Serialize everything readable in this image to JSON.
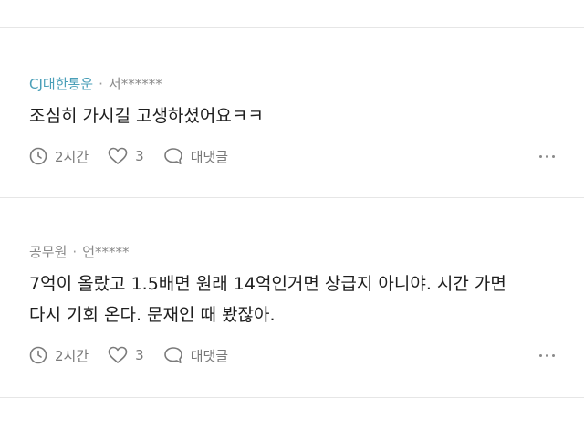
{
  "comments": [
    {
      "company": "CJ대한통운",
      "separator": "·",
      "user": "서******",
      "text": "조심히 가시길 고생하셨어요ㅋㅋ",
      "time": "2시간",
      "likes": "3",
      "reply_label": "대댓글"
    },
    {
      "company": "공무원",
      "separator": "·",
      "user": "언*****",
      "text": "7억이 올랐고 1.5배면 원래 14억인거면 상급지 아니야. 시간 가면\n다시 기회 온다. 문재인 때 봤잖아.",
      "time": "2시간",
      "likes": "3",
      "reply_label": "대댓글"
    }
  ],
  "icons": {
    "clock": "clock-icon",
    "like": "heart-icon",
    "reply": "speech-bubble-icon",
    "more": "more-horizontal-icon"
  },
  "colors": {
    "company_link": "#4a9fb8",
    "meta_gray": "#8a8a8a",
    "icon_gray": "#7a7a7a",
    "divider": "#e6e6e6"
  }
}
